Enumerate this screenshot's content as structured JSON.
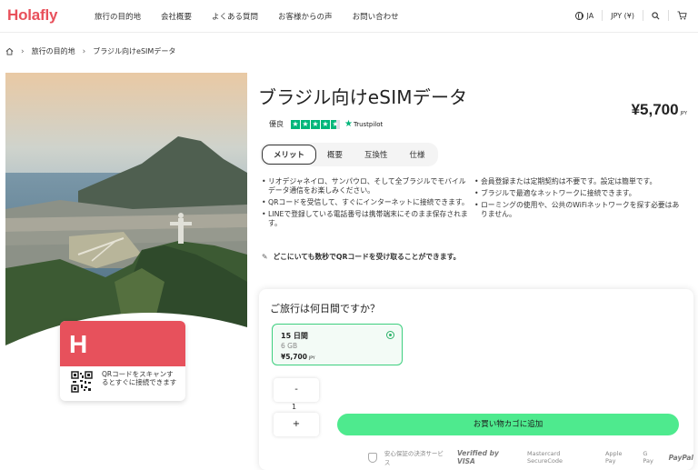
{
  "header": {
    "logo": "Holafly",
    "nav": [
      "旅行の目的地",
      "会社概要",
      "よくある質問",
      "お客様からの声",
      "お問い合わせ"
    ],
    "language": "JA",
    "currency": "JPY (¥)"
  },
  "breadcrumb": {
    "items": [
      "旅行の目的地",
      "ブラジル向けeSIMデータ"
    ]
  },
  "product": {
    "title": "ブラジル向けeSIMデータ",
    "price": "¥5,700",
    "price_currency": "JPY",
    "rating_label": "優良",
    "trustpilot": "Trustpilot",
    "tabs": [
      "メリット",
      "概要",
      "互換性",
      "仕様"
    ],
    "active_tab": 0,
    "features_left": [
      "リオデジャネイロ、サンパウロ、そして全ブラジルでモバイルデータ通信をお楽しみください。",
      "QRコードを受信して、すぐにインターネットに接続できます。",
      "LINEで登録している電話番号は携帯端末にそのまま保存されます。"
    ],
    "features_right": [
      "会員登録または定期契約は不要です。設定は簡単です。",
      "ブラジルで最適なネットワークに接続できます。",
      "ローミングの使用や、公共のWiFiネットワークを探す必要はありません。"
    ],
    "qr_note": "どこにいても数秒でQRコードを受け取ることができます。"
  },
  "simcard": {
    "logo_glyph": "H",
    "text": "QRコードをスキャンするとすぐに接続できます"
  },
  "booking": {
    "question": "ご旅行は何日間ですか？",
    "plan": {
      "days": "15 日間",
      "data": "6 GB",
      "price": "¥5,700",
      "currency": "JPY"
    },
    "decrement": "-",
    "quantity": "1",
    "increment": "+",
    "add_to_cart": "お買い物カゴに追加",
    "payments": [
      "安心保証の決済サービス",
      "Verified by VISA",
      "Mastercard SecureCode",
      "Apple Pay",
      "G Pay",
      "PayPal"
    ]
  },
  "colors": {
    "brand": "#e8505b",
    "cta": "#4eea8e",
    "selected_border": "#3ecf7f",
    "trustpilot": "#00b67a"
  }
}
